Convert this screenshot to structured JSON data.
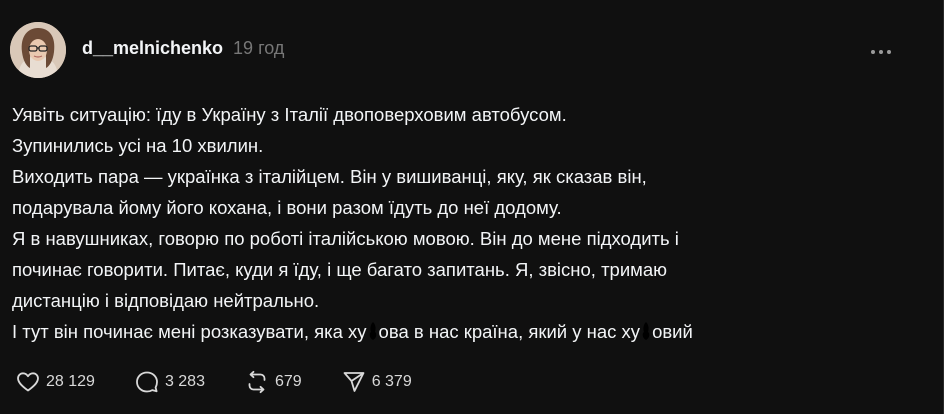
{
  "post": {
    "username": "d__melnichenko",
    "time": "19 год",
    "lines": [
      "Уявіть ситуацію: їду в Україну з Італії двоповерховим автобусом.",
      "Зупинились усі на 10 хвилин.",
      "Виходить пара — українка з італійцем. Він у вишиванці, яку, як сказав він,",
      "подарувала йому його кохана, і вони разом їдуть до неї додому.",
      "Я в навушниках, говорю по роботі італійською мовою. Він до мене підходить і",
      "починає говорити. Питає, куди я їду, і ще багато запитань. Я, звісно, тримаю",
      "дистанцію і відповідаю нейтрально.",
      "І тут він починає мені розказувати, яка ху",
      "ова в нас країна, який у нас ху",
      "овий"
    ]
  },
  "actions": {
    "likes": "28 129",
    "replies": "3 283",
    "reposts": "679",
    "shares": "6 379"
  },
  "icons": {
    "like": "heart-icon",
    "reply": "comment-bubble-icon",
    "repost": "repost-arrows-icon",
    "share": "send-icon",
    "more": "more-dots-icon"
  },
  "colors": {
    "background": "#101010",
    "text": "#f3f5f7",
    "muted": "#777777"
  }
}
